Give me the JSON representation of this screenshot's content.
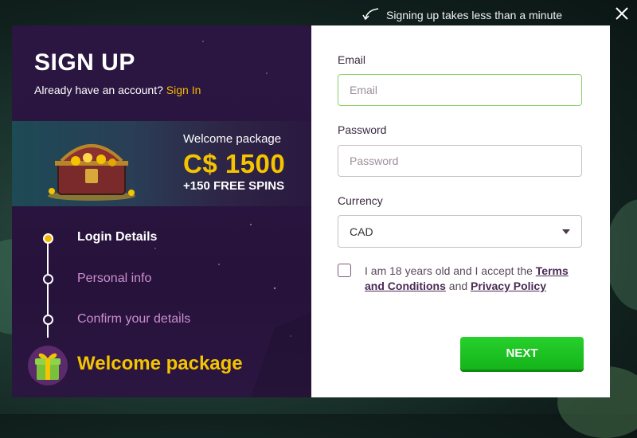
{
  "top_hint": {
    "text": "Signing up takes less than a minute",
    "icon": "arrow-curve-icon"
  },
  "close": {
    "icon": "close-icon"
  },
  "left_panel": {
    "title": "SIGN UP",
    "account_prompt": "Already have an account?",
    "signin_link": "Sign In",
    "promo": {
      "label": "Welcome package",
      "amount": "C$ 1500",
      "spins": "+150 FREE SPINS"
    },
    "steps": [
      {
        "label": "Login Details",
        "state": "active"
      },
      {
        "label": "Personal info",
        "state": "inactive"
      },
      {
        "label": "Confirm your details",
        "state": "inactive"
      }
    ],
    "welcome_package": "Welcome package"
  },
  "form": {
    "email": {
      "label": "Email",
      "placeholder": "Email",
      "value": ""
    },
    "password": {
      "label": "Password",
      "placeholder": "Password",
      "value": ""
    },
    "currency": {
      "label": "Currency",
      "selected": "CAD"
    },
    "terms": {
      "prefix": "I am 18 years old and I accept the",
      "terms_link": "Terms and Conditions",
      "and": "and",
      "privacy_link": "Privacy Policy",
      "checked": false
    },
    "next_label": "NEXT"
  },
  "colors": {
    "accent_yellow": "#f5c400",
    "next_green": "#1bbf21",
    "panel_purple": "#2a1540",
    "focus_green": "#8ad16b"
  }
}
